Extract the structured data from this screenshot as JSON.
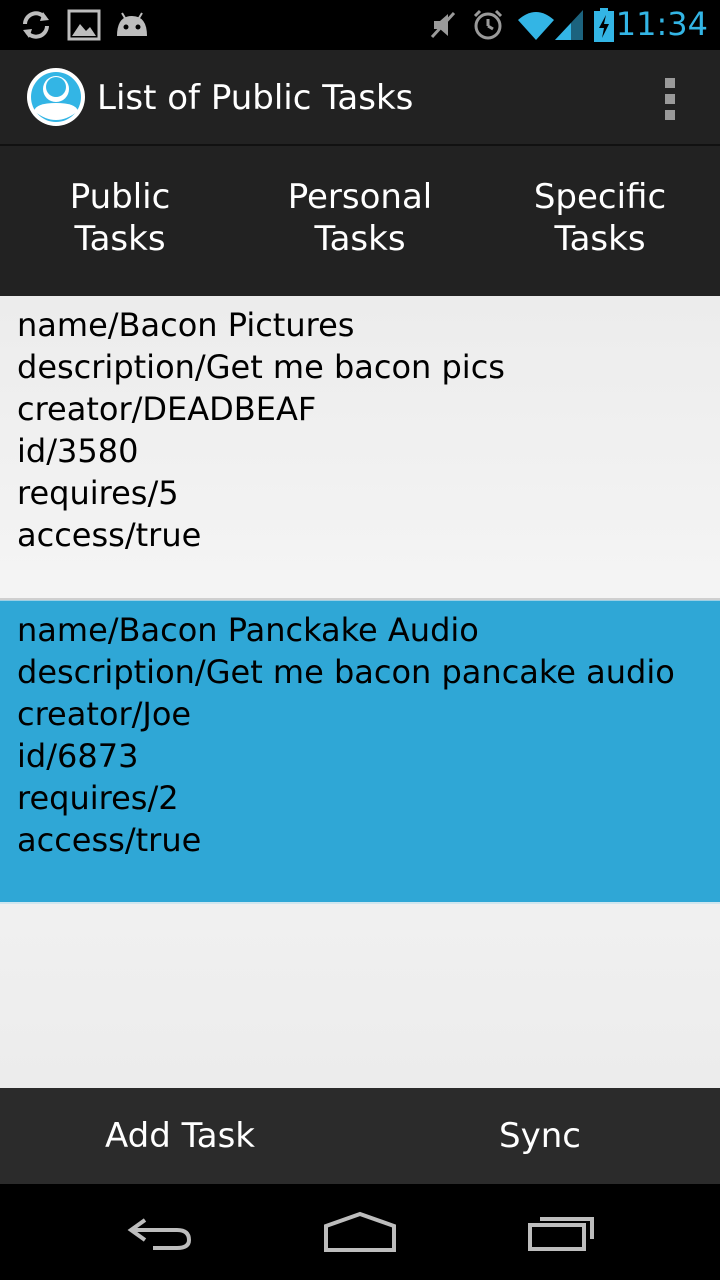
{
  "status_bar": {
    "time": "11:34",
    "accent": "#33b5e5",
    "left_icons": [
      "sync-icon",
      "image-icon",
      "android-icon"
    ],
    "right_icons": [
      "mute-icon",
      "alarm-icon",
      "wifi-icon",
      "signal-icon",
      "battery-charging-icon"
    ]
  },
  "action_bar": {
    "title": "List of Public Tasks",
    "logo_icon": "app-logo-icon",
    "overflow_icon": "overflow-menu-icon"
  },
  "tabs": [
    {
      "label": "Public\nTasks"
    },
    {
      "label": "Personal\nTasks"
    },
    {
      "label": "Specific\nTasks"
    }
  ],
  "tasks": [
    {
      "selected": false,
      "lines": [
        "name/Bacon Pictures",
        "description/Get me bacon pics",
        "creator/DEADBEAF",
        "id/3580",
        "requires/5",
        "access/true"
      ]
    },
    {
      "selected": true,
      "lines": [
        "name/Bacon Panckake Audio",
        "description/Get me bacon pancake audio",
        "creator/Joe",
        "id/6873",
        "requires/2",
        "access/true"
      ]
    }
  ],
  "bottom_buttons": {
    "add_task": "Add Task",
    "sync": "Sync"
  },
  "colors": {
    "selected_row": "#2fa7d6",
    "bar_background": "#222222"
  },
  "nav_icons": [
    "back-icon",
    "home-icon",
    "recent-apps-icon"
  ]
}
